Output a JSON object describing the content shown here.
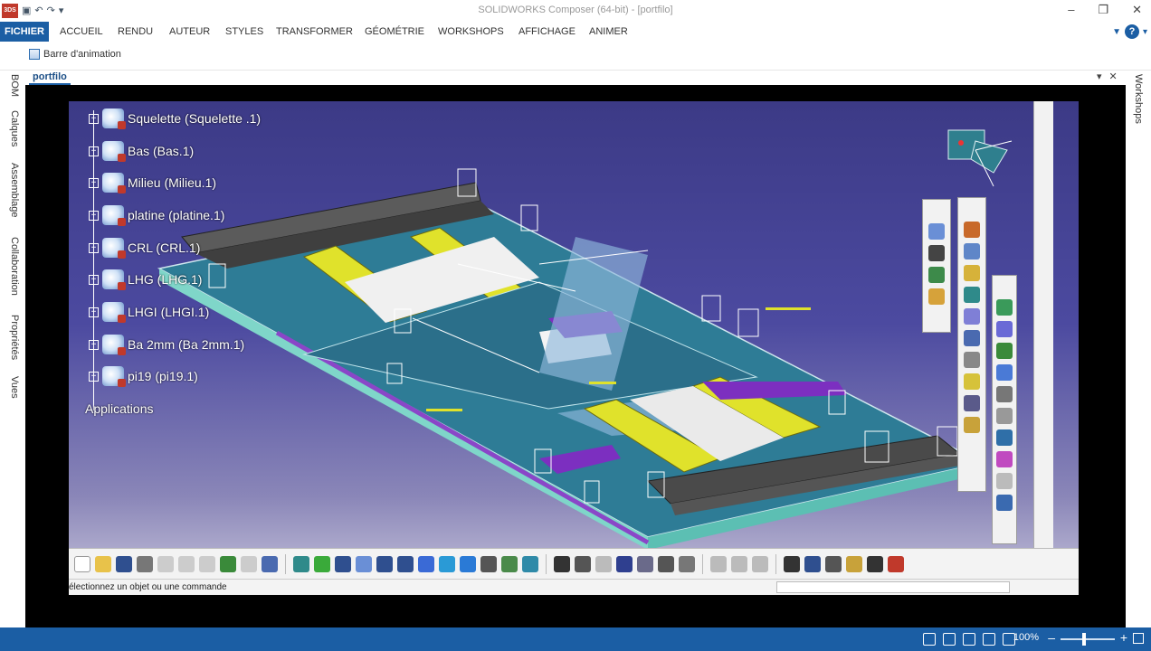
{
  "window": {
    "title": "SOLIDWORKS Composer (64-bit) - [portfilo]",
    "app_logo": "3DS",
    "minimize": "–",
    "restore": "❐",
    "close": "✕"
  },
  "ribbon": {
    "tabs": [
      {
        "label": "FICHIER"
      },
      {
        "label": "ACCUEIL"
      },
      {
        "label": "RENDU"
      },
      {
        "label": "AUTEUR"
      },
      {
        "label": "STYLES"
      },
      {
        "label": "TRANSFORMER"
      },
      {
        "label": "GÉOMÉTRIE"
      },
      {
        "label": "WORKSHOPS"
      },
      {
        "label": "AFFICHAGE"
      },
      {
        "label": "ANIMER"
      }
    ],
    "animation_bar_label": "Barre d'animation",
    "help_label": "?"
  },
  "left_rail": {
    "tabs": [
      "BOM",
      "Calques",
      "Assemblage",
      "Collaboration",
      "Propriétés",
      "Vues"
    ]
  },
  "right_rail": {
    "tabs": [
      "Workshops"
    ]
  },
  "document": {
    "tab_label": "portfilo",
    "dropdown": "▾",
    "close": "✕"
  },
  "spec_tree": {
    "items": [
      {
        "label": "Squelette  (Squelette .1)"
      },
      {
        "label": "Bas (Bas.1)"
      },
      {
        "label": "Milieu (Milieu.1)"
      },
      {
        "label": "platine (platine.1)"
      },
      {
        "label": "CRL (CRL.1)"
      },
      {
        "label": "LHG (LHG.1)"
      },
      {
        "label": "LHGI (LHGI.1)"
      },
      {
        "label": "Ba 2mm (Ba 2mm.1)"
      },
      {
        "label": "pi19 (pi19.1)"
      }
    ],
    "applications_label": "Applications"
  },
  "catia_status": {
    "message": "électionnez un objet ou une commande"
  },
  "statusbar": {
    "zoom": "100%"
  },
  "colors": {
    "accent": "#1b5ea4",
    "catia_bg_top": "#3c3a86",
    "catia_bg_bottom": "#c9c6dc"
  }
}
